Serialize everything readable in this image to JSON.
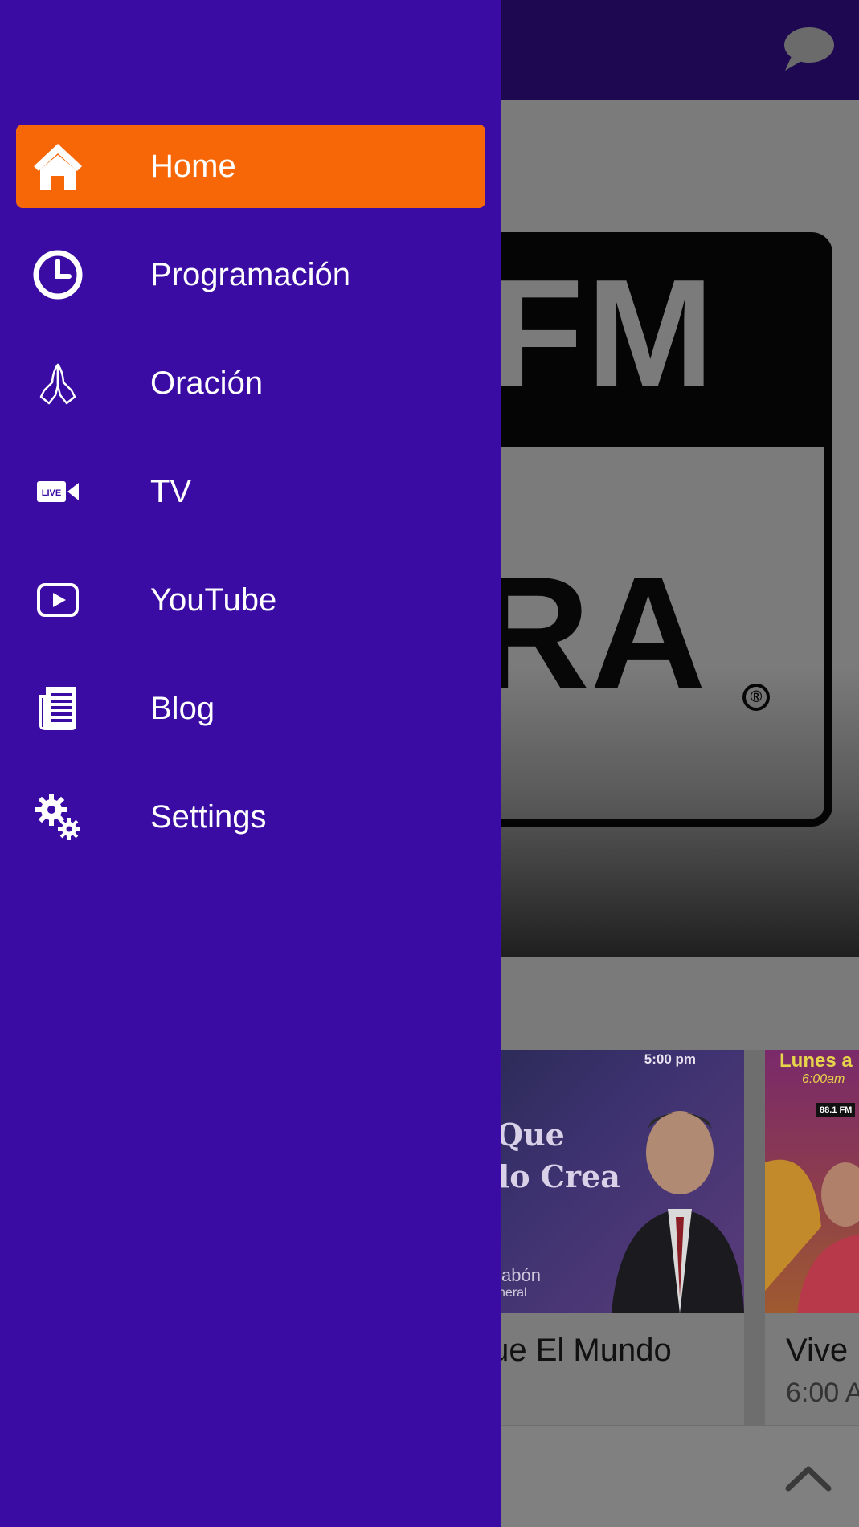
{
  "drawer": {
    "background": "#3a0ca3",
    "active_color": "#f76707",
    "items": [
      {
        "label": "Home",
        "icon": "home-icon",
        "active": true
      },
      {
        "label": "Programación",
        "icon": "clock-icon",
        "active": false
      },
      {
        "label": "Oración",
        "icon": "praying-hands-icon",
        "active": false
      },
      {
        "label": "TV",
        "icon": "live-video-icon",
        "active": false
      },
      {
        "label": "YouTube",
        "icon": "youtube-play-icon",
        "active": false
      },
      {
        "label": "Blog",
        "icon": "news-article-icon",
        "active": false
      },
      {
        "label": "Settings",
        "icon": "gears-icon",
        "active": false
      }
    ]
  },
  "background_app": {
    "topbar_color": "#1e0852",
    "topbar_icon": "chat-bubble-icon",
    "hero_logo": {
      "top_text": "FM",
      "bottom_text": "RA",
      "mark": "®"
    },
    "programs": [
      {
        "title": "Que El Mundo",
        "image_text_line1": "a Que",
        "image_text_line2": "ndo Crea",
        "image_host": "az Pabón",
        "image_role": "or General",
        "image_time": "5:00 pm"
      },
      {
        "title": "Vive",
        "subtitle": "6:00 A",
        "image_text_line1": "Lunes a",
        "image_time": "6:00am",
        "image_badge": "88.1 FM"
      }
    ],
    "bottom_icon": "chevron-up-icon"
  }
}
